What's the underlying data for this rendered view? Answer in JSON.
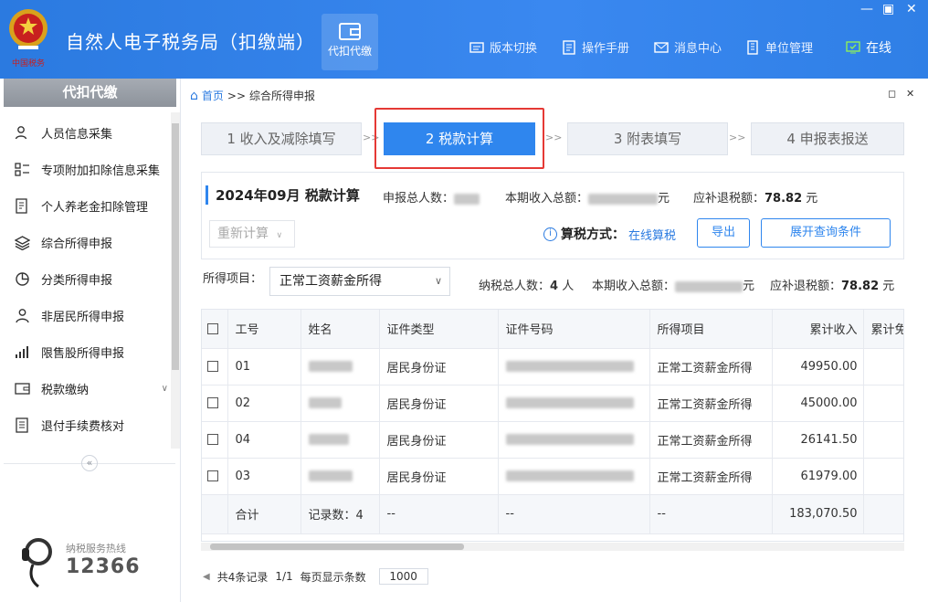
{
  "header": {
    "emblem_text": "中国税务",
    "title": "自然人电子税务局（扣缴端）",
    "tile_label": "代扣代缴",
    "nav": [
      {
        "label": "版本切换",
        "icon": "version-switch-icon"
      },
      {
        "label": "操作手册",
        "icon": "manual-icon"
      },
      {
        "label": "消息中心",
        "icon": "message-icon"
      },
      {
        "label": "单位管理",
        "icon": "building-icon"
      },
      {
        "label": "在线",
        "icon": "online-monitor-icon"
      }
    ],
    "colors": {
      "bar": "#2f7fe6",
      "accent": "#2f86ee",
      "highlight": "#e53935"
    }
  },
  "sidebar": {
    "title": "代扣代缴",
    "items": [
      {
        "label": "人员信息采集",
        "icon": "person-icon"
      },
      {
        "label": "专项附加扣除信息采集",
        "icon": "grid-list-icon"
      },
      {
        "label": "个人养老金扣除管理",
        "icon": "document-edit-icon"
      },
      {
        "label": "综合所得申报",
        "icon": "layers-icon"
      },
      {
        "label": "分类所得申报",
        "icon": "pie-icon"
      },
      {
        "label": "非居民所得申报",
        "icon": "user-outline-icon"
      },
      {
        "label": "限售股所得申报",
        "icon": "bar-chart-icon"
      },
      {
        "label": "税款缴纳",
        "icon": "wallet-icon"
      },
      {
        "label": "退付手续费核对",
        "icon": "receipt-icon"
      }
    ],
    "hotline_label": "纳税服务热线",
    "hotline_number": "12366"
  },
  "breadcrumb": {
    "home": "首页",
    "sep": ">>",
    "current": "综合所得申报"
  },
  "steps": [
    {
      "label": "1 收入及减除填写"
    },
    {
      "label": "2 税款计算"
    },
    {
      "label": "3 附表填写"
    },
    {
      "label": "4 申报表报送"
    }
  ],
  "step_sep": ">>",
  "summary": {
    "period_title": "2024年09月  税款计算",
    "people_label": "申报总人数：",
    "income_label": "本期收入总额：",
    "yuan": "元",
    "tax_label": "应补退税额：",
    "tax_value": "78.82",
    "recalc": "重新计算",
    "method_label": "算税方式：",
    "method_value": "在线算税",
    "export": "导出",
    "expand": "展开查询条件"
  },
  "filter": {
    "label": "所得项目：",
    "value": "正常工资薪金所得",
    "taxpayers_label": "纳税总人数：",
    "taxpayers_value": "4",
    "taxpayers_unit": "人",
    "income_label": "本期收入总额：",
    "yuan": "元",
    "tax_label": "应补退税额：",
    "tax_value": "78.82",
    "unit": "元"
  },
  "table": {
    "columns": [
      "工号",
      "姓名",
      "证件类型",
      "证件号码",
      "所得项目",
      "累计收入",
      "累计免"
    ],
    "rows": [
      {
        "id": "01",
        "id_type": "居民身份证",
        "item": "正常工资薪金所得",
        "income": "49950.00"
      },
      {
        "id": "02",
        "id_type": "居民身份证",
        "item": "正常工资薪金所得",
        "income": "45000.00"
      },
      {
        "id": "04",
        "id_type": "居民身份证",
        "item": "正常工资薪金所得",
        "income": "26141.50"
      },
      {
        "id": "03",
        "id_type": "居民身份证",
        "item": "正常工资薪金所得",
        "income": "61979.00"
      }
    ],
    "footer": {
      "total": "合计",
      "records": "记录数：4",
      "dash": "--",
      "income_total": "183,070.50"
    }
  },
  "pager": {
    "total": "共4条记录",
    "page": "1/1",
    "per_page_label": "每页显示条数",
    "per_page": "1000"
  }
}
